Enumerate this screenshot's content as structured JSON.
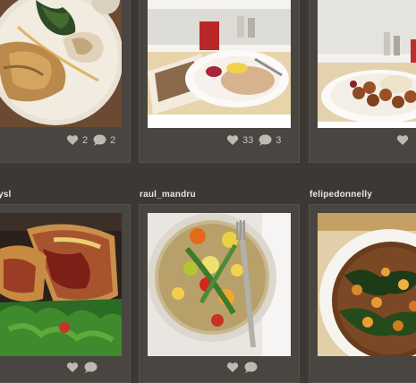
{
  "posts": [
    {
      "username": "",
      "likes": "2",
      "comments": "2",
      "photo": "plate-fish-greens-icon"
    },
    {
      "username": "",
      "likes": "33",
      "comments": "3",
      "photo": "tray-meal-icon"
    },
    {
      "username": "",
      "likes": "",
      "comments": "",
      "photo": "meatballs-plate-icon"
    },
    {
      "username": "ysl",
      "likes": "",
      "comments": "",
      "photo": "sandwich-salad-icon"
    },
    {
      "username": "raul_mandru",
      "likes": "",
      "comments": "",
      "photo": "grain-bowl-icon"
    },
    {
      "username": "felipedonnelly",
      "likes": "",
      "comments": "",
      "photo": "kale-stew-bowl-icon"
    }
  ],
  "icons": {
    "like": "heart-icon",
    "comment": "speech-bubble-icon"
  },
  "colors": {
    "background": "#3c3935",
    "card": "#494540",
    "stats_text": "#c7c4bf",
    "username": "#e9e6e1"
  }
}
